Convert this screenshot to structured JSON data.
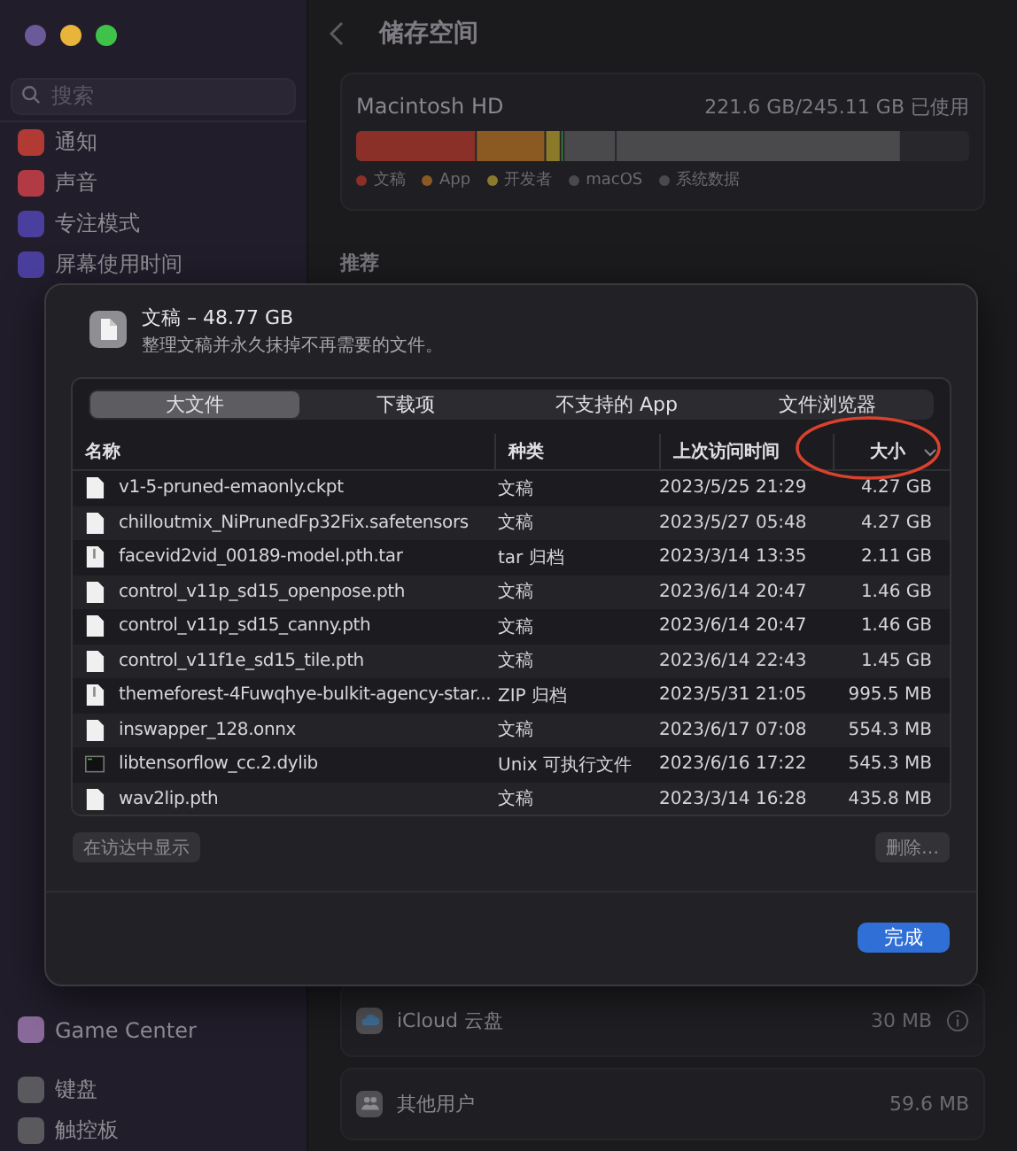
{
  "window": {
    "title": "储存空间"
  },
  "sidebar": {
    "search": {
      "placeholder": "搜索"
    },
    "items": [
      {
        "label": "通知",
        "color": "#b23a34"
      },
      {
        "label": "声音",
        "color": "#b23a45"
      },
      {
        "label": "专注模式",
        "color": "#4b3f9e"
      },
      {
        "label": "屏幕使用时间",
        "color": "#4b3f9e"
      }
    ],
    "lower_items": [
      {
        "label": "Game Center",
        "color": "#8a6a9a"
      },
      {
        "label": "键盘",
        "color": "#5a5a5e"
      },
      {
        "label": "触控板",
        "color": "#5a5a5e"
      }
    ]
  },
  "disk": {
    "name": "Macintosh HD",
    "usage": "221.6 GB/245.11 GB 已使用",
    "legend": [
      {
        "label": "文稿",
        "color": "#8a3028"
      },
      {
        "label": "App",
        "color": "#8a5a22"
      },
      {
        "label": "开发者",
        "color": "#8a7a2a"
      },
      {
        "label": "macOS",
        "color": "#4a4a4c"
      },
      {
        "label": "系统数据",
        "color": "#4a4a4c"
      }
    ]
  },
  "recommend_heading": "推荐",
  "categories": [
    {
      "label": "iCloud 云盘",
      "size": "30 MB",
      "info": true
    },
    {
      "label": "其他用户",
      "size": "59.6 MB",
      "info": false
    }
  ],
  "dialog": {
    "title": "文稿 – 48.77 GB",
    "subtitle": "整理文稿并永久抹掉不再需要的文件。",
    "tabs": [
      {
        "label": "大文件",
        "selected": true
      },
      {
        "label": "下载项",
        "selected": false
      },
      {
        "label": "不支持的 App",
        "selected": false
      },
      {
        "label": "文件浏览器",
        "selected": false
      }
    ],
    "columns": [
      {
        "label": "名称",
        "sorted": false
      },
      {
        "label": "种类",
        "sorted": false
      },
      {
        "label": "上次访问时间",
        "sorted": false
      },
      {
        "label": "大小",
        "sorted": true
      }
    ],
    "highlight_circle": true,
    "rows": [
      {
        "kind": "document",
        "name": "v1-5-pruned-emaonly.ckpt",
        "type": "文稿",
        "accessed": "2023/5/25 21:29",
        "size": "4.27 GB"
      },
      {
        "kind": "document",
        "name": "chilloutmix_NiPrunedFp32Fix.safetensors",
        "type": "文稿",
        "accessed": "2023/5/27 05:48",
        "size": "4.27 GB"
      },
      {
        "kind": "archive",
        "name": "facevid2vid_00189-model.pth.tar",
        "type": "tar 归档",
        "accessed": "2023/3/14 13:35",
        "size": "2.11 GB"
      },
      {
        "kind": "document",
        "name": "control_v11p_sd15_openpose.pth",
        "type": "文稿",
        "accessed": "2023/6/14 20:47",
        "size": "1.46 GB"
      },
      {
        "kind": "document",
        "name": "control_v11p_sd15_canny.pth",
        "type": "文稿",
        "accessed": "2023/6/14 20:47",
        "size": "1.46 GB"
      },
      {
        "kind": "document",
        "name": "control_v11f1e_sd15_tile.pth",
        "type": "文稿",
        "accessed": "2023/6/14 22:43",
        "size": "1.45 GB"
      },
      {
        "kind": "archive",
        "name": "themeforest-4Fuwqhye-bulkit-agency-star...",
        "type": "ZIP 归档",
        "accessed": "2023/5/31 21:05",
        "size": "995.5 MB"
      },
      {
        "kind": "document",
        "name": "inswapper_128.onnx",
        "type": "文稿",
        "accessed": "2023/6/17 07:08",
        "size": "554.3 MB"
      },
      {
        "kind": "executable",
        "name": "libtensorflow_cc.2.dylib",
        "type": "Unix 可执行文件",
        "accessed": "2023/6/16 17:22",
        "size": "545.3 MB"
      },
      {
        "kind": "document",
        "name": "wav2lip.pth",
        "type": "文稿",
        "accessed": "2023/3/14 16:28",
        "size": "435.8 MB"
      }
    ],
    "buttons": [
      {
        "label": "在访达中显示",
        "disabled": true
      },
      {
        "label": "删除…",
        "disabled": true
      }
    ],
    "done_button": "完成"
  }
}
